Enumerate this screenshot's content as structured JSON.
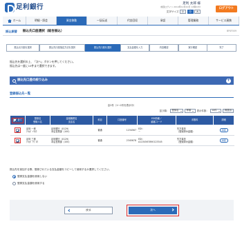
{
  "header": {
    "bank_name": "足利銀行",
    "user_name": "足利 太郎 様",
    "last_login": "前回ログイン 2014年12月10日 12時04分",
    "font_size_label": "文字サイズ",
    "font_sizes": [
      "小",
      "中",
      "大"
    ],
    "logout_label": "ログアウト"
  },
  "global_nav": {
    "home_label": "ホーム",
    "items": [
      "明細・照会",
      "資金移動",
      "一括伝送",
      "代金回収",
      "承認",
      "管理業務",
      "サービス連携"
    ]
  },
  "page": {
    "category": "振込振替",
    "title": "振込先口座選択（総合振込）",
    "screen_id": "BFKF009"
  },
  "steps": [
    "振込元口座を選択",
    "振込先口座指定方法を選択",
    "振込先口座を選択",
    "支払金額を入力",
    "内容確認",
    "実行確認",
    "完了"
  ],
  "instruction": {
    "line1": "振込先を選択の上、「次へ」ボタンを押してください。",
    "line2": "振込先は一度に10件まで選択できます。"
  },
  "search_panel": {
    "label": "振込先口座の絞り込み"
  },
  "registered_list": {
    "title": "登録振込先一覧",
    "count_text": "全2件（1〜2件を表示中）",
    "sort_label": "並び順：",
    "sort_value": "登録名",
    "order_value": "昇順",
    "per_page_label": "表示件数：",
    "per_page_value": "10件",
    "sort_button": "再表示",
    "columns": {
      "all": "全て",
      "registered_name": "登録名\n受取人名",
      "bank_branch": "金融機関名\n支店名",
      "account_type": "科目",
      "account_no": "口座番号",
      "edi": "EDI情報／\n顧客コード",
      "fee": "手数料",
      "detail": "詳細"
    },
    "rows": [
      {
        "checked": true,
        "registered_name": "足利 一郎",
        "payee_name": "ｱｼｶｶﾞ ｲﾁﾛｳ",
        "bank": "足利銀行（0129）",
        "branch": "本店営業部（100）",
        "account_type": "普通",
        "account_no": "1234567",
        "edi": "EDI：",
        "customer_code": "－",
        "fee": "先方負担",
        "fee_note": "（登録済み金額）",
        "detail_label": "詳細"
      },
      {
        "checked": true,
        "registered_name": "足利 三郎",
        "payee_name": "ｱｼｶｶﾞ ｻﾌﾞﾛｳ",
        "bank": "足利銀行（0129）",
        "branch": "本店営業部（100）",
        "account_type": "普通",
        "account_no": "2345678",
        "edi": "EDI：",
        "customer_code": "A1234567890123345",
        "fee": "先方負担",
        "fee_note": "（登録済み金額）",
        "detail_label": "詳細"
      }
    ]
  },
  "copy_option": {
    "note": "振込先を追加する際、登録されている支払金額をコピーして使用するか選択してください。",
    "options": [
      "登録支払金額を使用しない",
      "登録支払金額を使用する"
    ],
    "selected_index": 0
  },
  "actions": {
    "back_label": "戻る",
    "next_label": "次へ"
  },
  "colors": {
    "primary": "#2b6ab8",
    "header_blue": "#2d5aa3",
    "logout_orange": "#f37a1f",
    "highlight_red": "#e02b2b"
  }
}
